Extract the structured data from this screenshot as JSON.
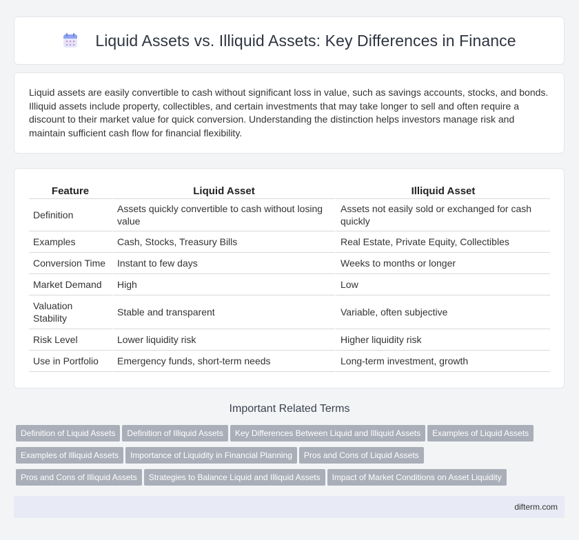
{
  "header": {
    "title": "Liquid Assets vs. Illiquid Assets: Key Differences in Finance"
  },
  "intro": {
    "text": "Liquid assets are easily convertible to cash without significant loss in value, such as savings accounts, stocks, and bonds. Illiquid assets include property, collectibles, and certain investments that may take longer to sell and often require a discount to their market value for quick conversion. Understanding the distinction helps investors manage risk and maintain sufficient cash flow for financial flexibility."
  },
  "table": {
    "headers": [
      "Feature",
      "Liquid Asset",
      "Illiquid Asset"
    ],
    "rows": [
      [
        "Definition",
        "Assets quickly convertible to cash without losing value",
        "Assets not easily sold or exchanged for cash quickly"
      ],
      [
        "Examples",
        "Cash, Stocks, Treasury Bills",
        "Real Estate, Private Equity, Collectibles"
      ],
      [
        "Conversion Time",
        "Instant to few days",
        "Weeks to months or longer"
      ],
      [
        "Market Demand",
        "High",
        "Low"
      ],
      [
        "Valuation Stability",
        "Stable and transparent",
        "Variable, often subjective"
      ],
      [
        "Risk Level",
        "Lower liquidity risk",
        "Higher liquidity risk"
      ],
      [
        "Use in Portfolio",
        "Emergency funds, short-term needs",
        "Long-term investment, growth"
      ]
    ]
  },
  "related": {
    "title": "Important Related Terms",
    "tags": [
      "Definition of Liquid Assets",
      "Definition of Illiquid Assets",
      "Key Differences Between Liquid and Illiquid Assets",
      "Examples of Liquid Assets",
      "Examples of Illiquid Assets",
      "Importance of Liquidity in Financial Planning",
      "Pros and Cons of Liquid Assets",
      "Pros and Cons of Illiquid Assets",
      "Strategies to Balance Liquid and Illiquid Assets",
      "Impact of Market Conditions on Asset Liquidity"
    ]
  },
  "footer": {
    "site": "difterm.com"
  },
  "icons": {
    "header": "calendar-icon"
  },
  "colors": {
    "tag_bg": "#a9aeb8",
    "footer_bg": "#e8ebf5",
    "page_bg": "#f3f4f6"
  }
}
